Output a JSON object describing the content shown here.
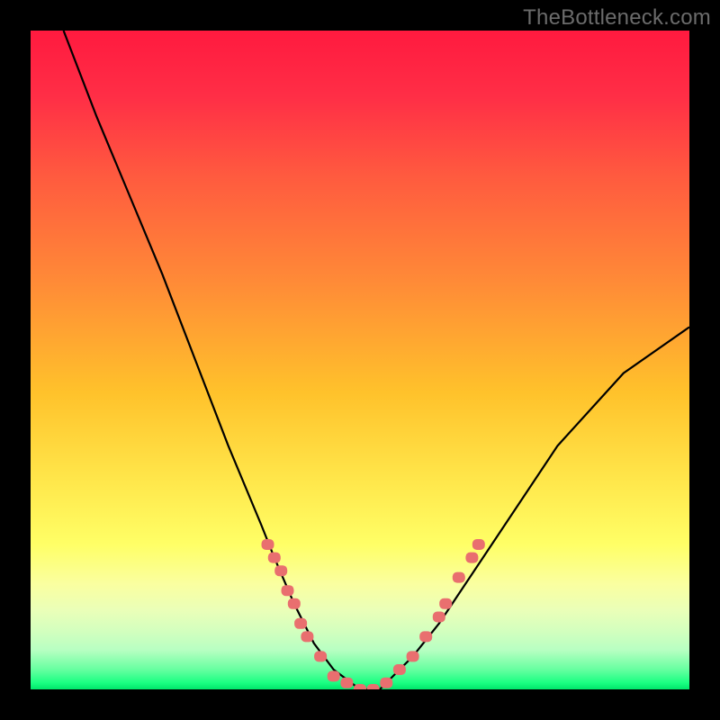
{
  "watermark": "TheBottleneck.com",
  "chart_data": {
    "type": "line",
    "title": "",
    "xlabel": "",
    "ylabel": "",
    "xlim": [
      0,
      100
    ],
    "ylim": [
      0,
      100
    ],
    "grid": false,
    "series": [
      {
        "name": "bottleneck-curve",
        "x": [
          5,
          10,
          15,
          20,
          25,
          30,
          35,
          37,
          40,
          43,
          46,
          50,
          53,
          55,
          58,
          62,
          70,
          80,
          90,
          100
        ],
        "y": [
          100,
          87,
          75,
          63,
          50,
          37,
          25,
          20,
          13,
          7,
          3,
          0,
          0,
          2,
          5,
          10,
          22,
          37,
          48,
          55
        ]
      }
    ],
    "markers": [
      {
        "x": 36,
        "y": 22
      },
      {
        "x": 37,
        "y": 20
      },
      {
        "x": 38,
        "y": 18
      },
      {
        "x": 39,
        "y": 15
      },
      {
        "x": 40,
        "y": 13
      },
      {
        "x": 41,
        "y": 10
      },
      {
        "x": 42,
        "y": 8
      },
      {
        "x": 44,
        "y": 5
      },
      {
        "x": 46,
        "y": 2
      },
      {
        "x": 48,
        "y": 1
      },
      {
        "x": 50,
        "y": 0
      },
      {
        "x": 52,
        "y": 0
      },
      {
        "x": 54,
        "y": 1
      },
      {
        "x": 56,
        "y": 3
      },
      {
        "x": 58,
        "y": 5
      },
      {
        "x": 60,
        "y": 8
      },
      {
        "x": 62,
        "y": 11
      },
      {
        "x": 63,
        "y": 13
      },
      {
        "x": 65,
        "y": 17
      },
      {
        "x": 67,
        "y": 20
      },
      {
        "x": 68,
        "y": 22
      }
    ],
    "marker_color": "#e96f6f",
    "curve_color": "#000000",
    "background_gradient": [
      "#ff1a3f",
      "#ff5a3f",
      "#ff8a37",
      "#ffc22b",
      "#ffe64a",
      "#ffff66",
      "#eaffb8",
      "#66ffa0",
      "#00e56a"
    ]
  }
}
